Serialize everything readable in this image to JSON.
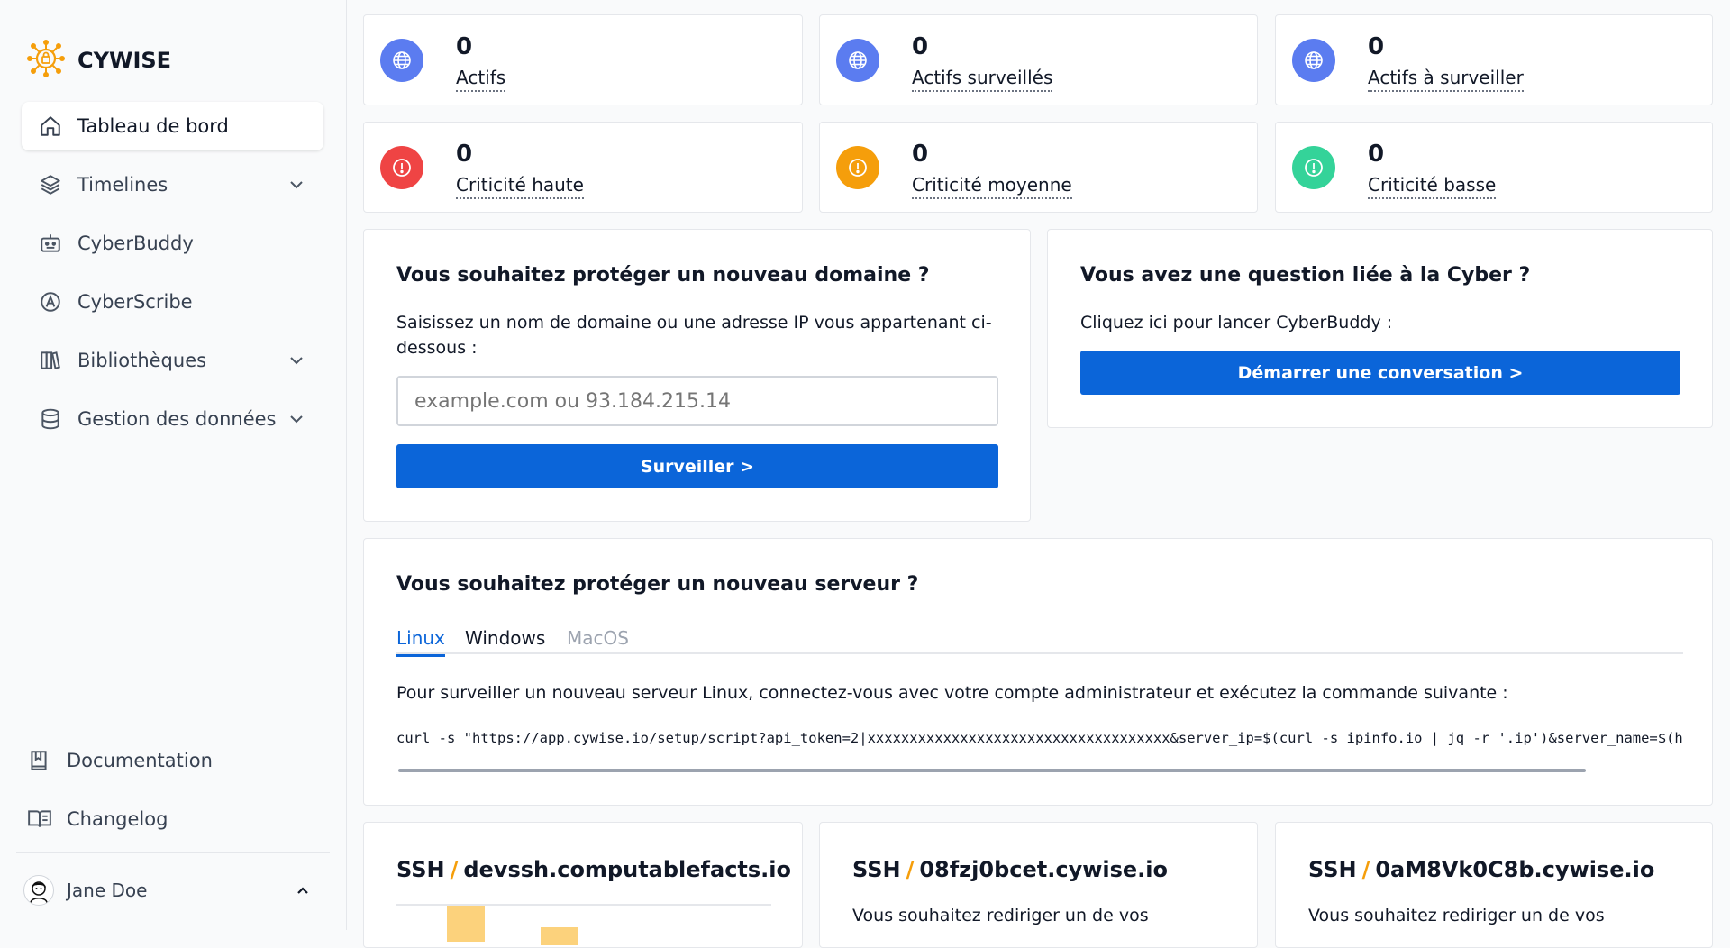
{
  "brand": {
    "name": "CYWISE"
  },
  "nav": {
    "items": [
      {
        "label": "Tableau de bord",
        "icon": "home-icon"
      },
      {
        "label": "Timelines",
        "icon": "layers-icon"
      },
      {
        "label": "CyberBuddy",
        "icon": "bot-icon"
      },
      {
        "label": "CyberScribe",
        "icon": "a-circle-icon"
      },
      {
        "label": "Bibliothèques",
        "icon": "library-icon"
      },
      {
        "label": "Gestion des données",
        "icon": "database-icon"
      }
    ],
    "bottom": [
      {
        "label": "Documentation",
        "icon": "book-icon"
      },
      {
        "label": "Changelog",
        "icon": "book-open-icon"
      }
    ],
    "user": {
      "name": "Jane Doe"
    }
  },
  "stats": [
    {
      "value": "0",
      "label": "Actifs",
      "color": "#5b7cf0"
    },
    {
      "value": "0",
      "label": "Actifs surveillés",
      "color": "#5b7cf0"
    },
    {
      "value": "0",
      "label": "Actifs à surveiller",
      "color": "#5b7cf0"
    },
    {
      "value": "0",
      "label": "Criticité haute",
      "color": "#ef4444"
    },
    {
      "value": "0",
      "label": "Criticité moyenne",
      "color": "#f59e0b"
    },
    {
      "value": "0",
      "label": "Criticité basse",
      "color": "#34d399"
    }
  ],
  "domain": {
    "title": "Vous souhaitez protéger un nouveau domaine ?",
    "text": "Saisissez un nom de domaine ou une adresse IP vous appartenant ci-dessous :",
    "placeholder": "example.com ou 93.184.215.14",
    "button": "Surveiller >"
  },
  "cyber": {
    "title": "Vous avez une question liée à la Cyber ?",
    "text": "Cliquez ici pour lancer CyberBuddy :",
    "button": "Démarrer une conversation >"
  },
  "server": {
    "title": "Vous souhaitez protéger un nouveau serveur ?",
    "tabs": [
      "Linux",
      "Windows",
      "MacOS"
    ],
    "text": "Pour surveiller un nouveau serveur Linux, connectez-vous avec votre compte administrateur et exécutez la commande suivante :",
    "command": "curl -s \"https://app.cywise.io/setup/script?api_token=2|xxxxxxxxxxxxxxxxxxxxxxxxxxxxxxxxxxxx&server_ip=$(curl -s ipinfo.io | jq -r '.ip')&server_name=$(hostname)\" | bash"
  },
  "ssh": [
    {
      "proto": "SSH",
      "host": "devssh.computablefacts.io",
      "text": ""
    },
    {
      "proto": "SSH",
      "host": "08fzj0bcet.cywise.io",
      "text": "Vous souhaitez rediriger un de vos"
    },
    {
      "proto": "SSH",
      "host": "0aM8Vk0C8b.cywise.io",
      "text": "Vous souhaitez rediriger un de vos"
    }
  ],
  "colors": {
    "primary": "#0b65d9",
    "accent": "#f59e0b"
  }
}
